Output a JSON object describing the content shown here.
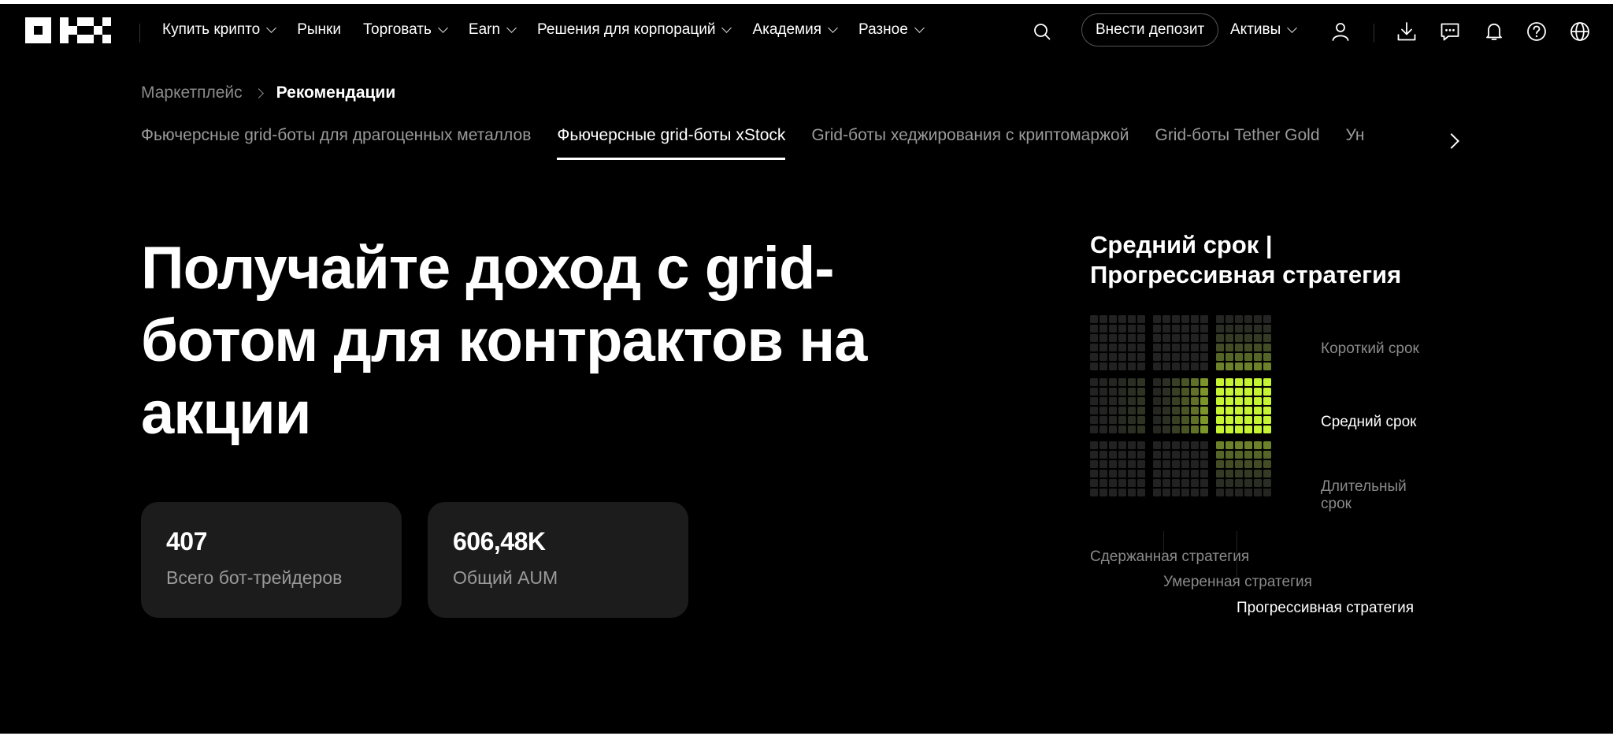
{
  "header": {
    "nav": [
      {
        "label": "Купить крипто",
        "dropdown": true
      },
      {
        "label": "Рынки",
        "dropdown": false
      },
      {
        "label": "Торговать",
        "dropdown": true
      },
      {
        "label": "Earn",
        "dropdown": true
      },
      {
        "label": "Решения для корпораций",
        "dropdown": true
      },
      {
        "label": "Академия",
        "dropdown": true
      },
      {
        "label": "Разное",
        "dropdown": true
      }
    ],
    "deposit_label": "Внести депозит",
    "assets_label": "Активы",
    "icons": [
      "search-icon",
      "user-icon",
      "download-icon",
      "chat-icon",
      "bell-icon",
      "help-icon",
      "globe-icon"
    ]
  },
  "breadcrumb": {
    "parent": "Маркетплейс",
    "current": "Рекомендации"
  },
  "tabs": [
    {
      "label": "Фьючерсные grid-боты для драгоценных металлов",
      "active": false
    },
    {
      "label": "Фьючерсные grid-боты xStock",
      "active": true
    },
    {
      "label": "Grid-боты хеджирования с криптомаржой",
      "active": false
    },
    {
      "label": "Grid-боты Tether Gold",
      "active": false
    },
    {
      "label": "Ун",
      "active": false
    }
  ],
  "hero": {
    "title": "Получайте доход с grid-ботом для контрактов на акции"
  },
  "stats": [
    {
      "value": "407",
      "label": "Всего бот-трейдеров"
    },
    {
      "value": "606,48K",
      "label": "Общий AUM"
    }
  ],
  "risk": {
    "title": "Средний срок | Прогрессивная стратегия",
    "rows": [
      "Короткий срок",
      "Средний срок",
      "Длительный срок"
    ],
    "columns": [
      "Сдержанная стратегия",
      "Умеренная стратегия",
      "Прогрессивная стратегия"
    ],
    "selected_row": 1,
    "selected_col": 2,
    "accent_color": "#c6f432"
  }
}
